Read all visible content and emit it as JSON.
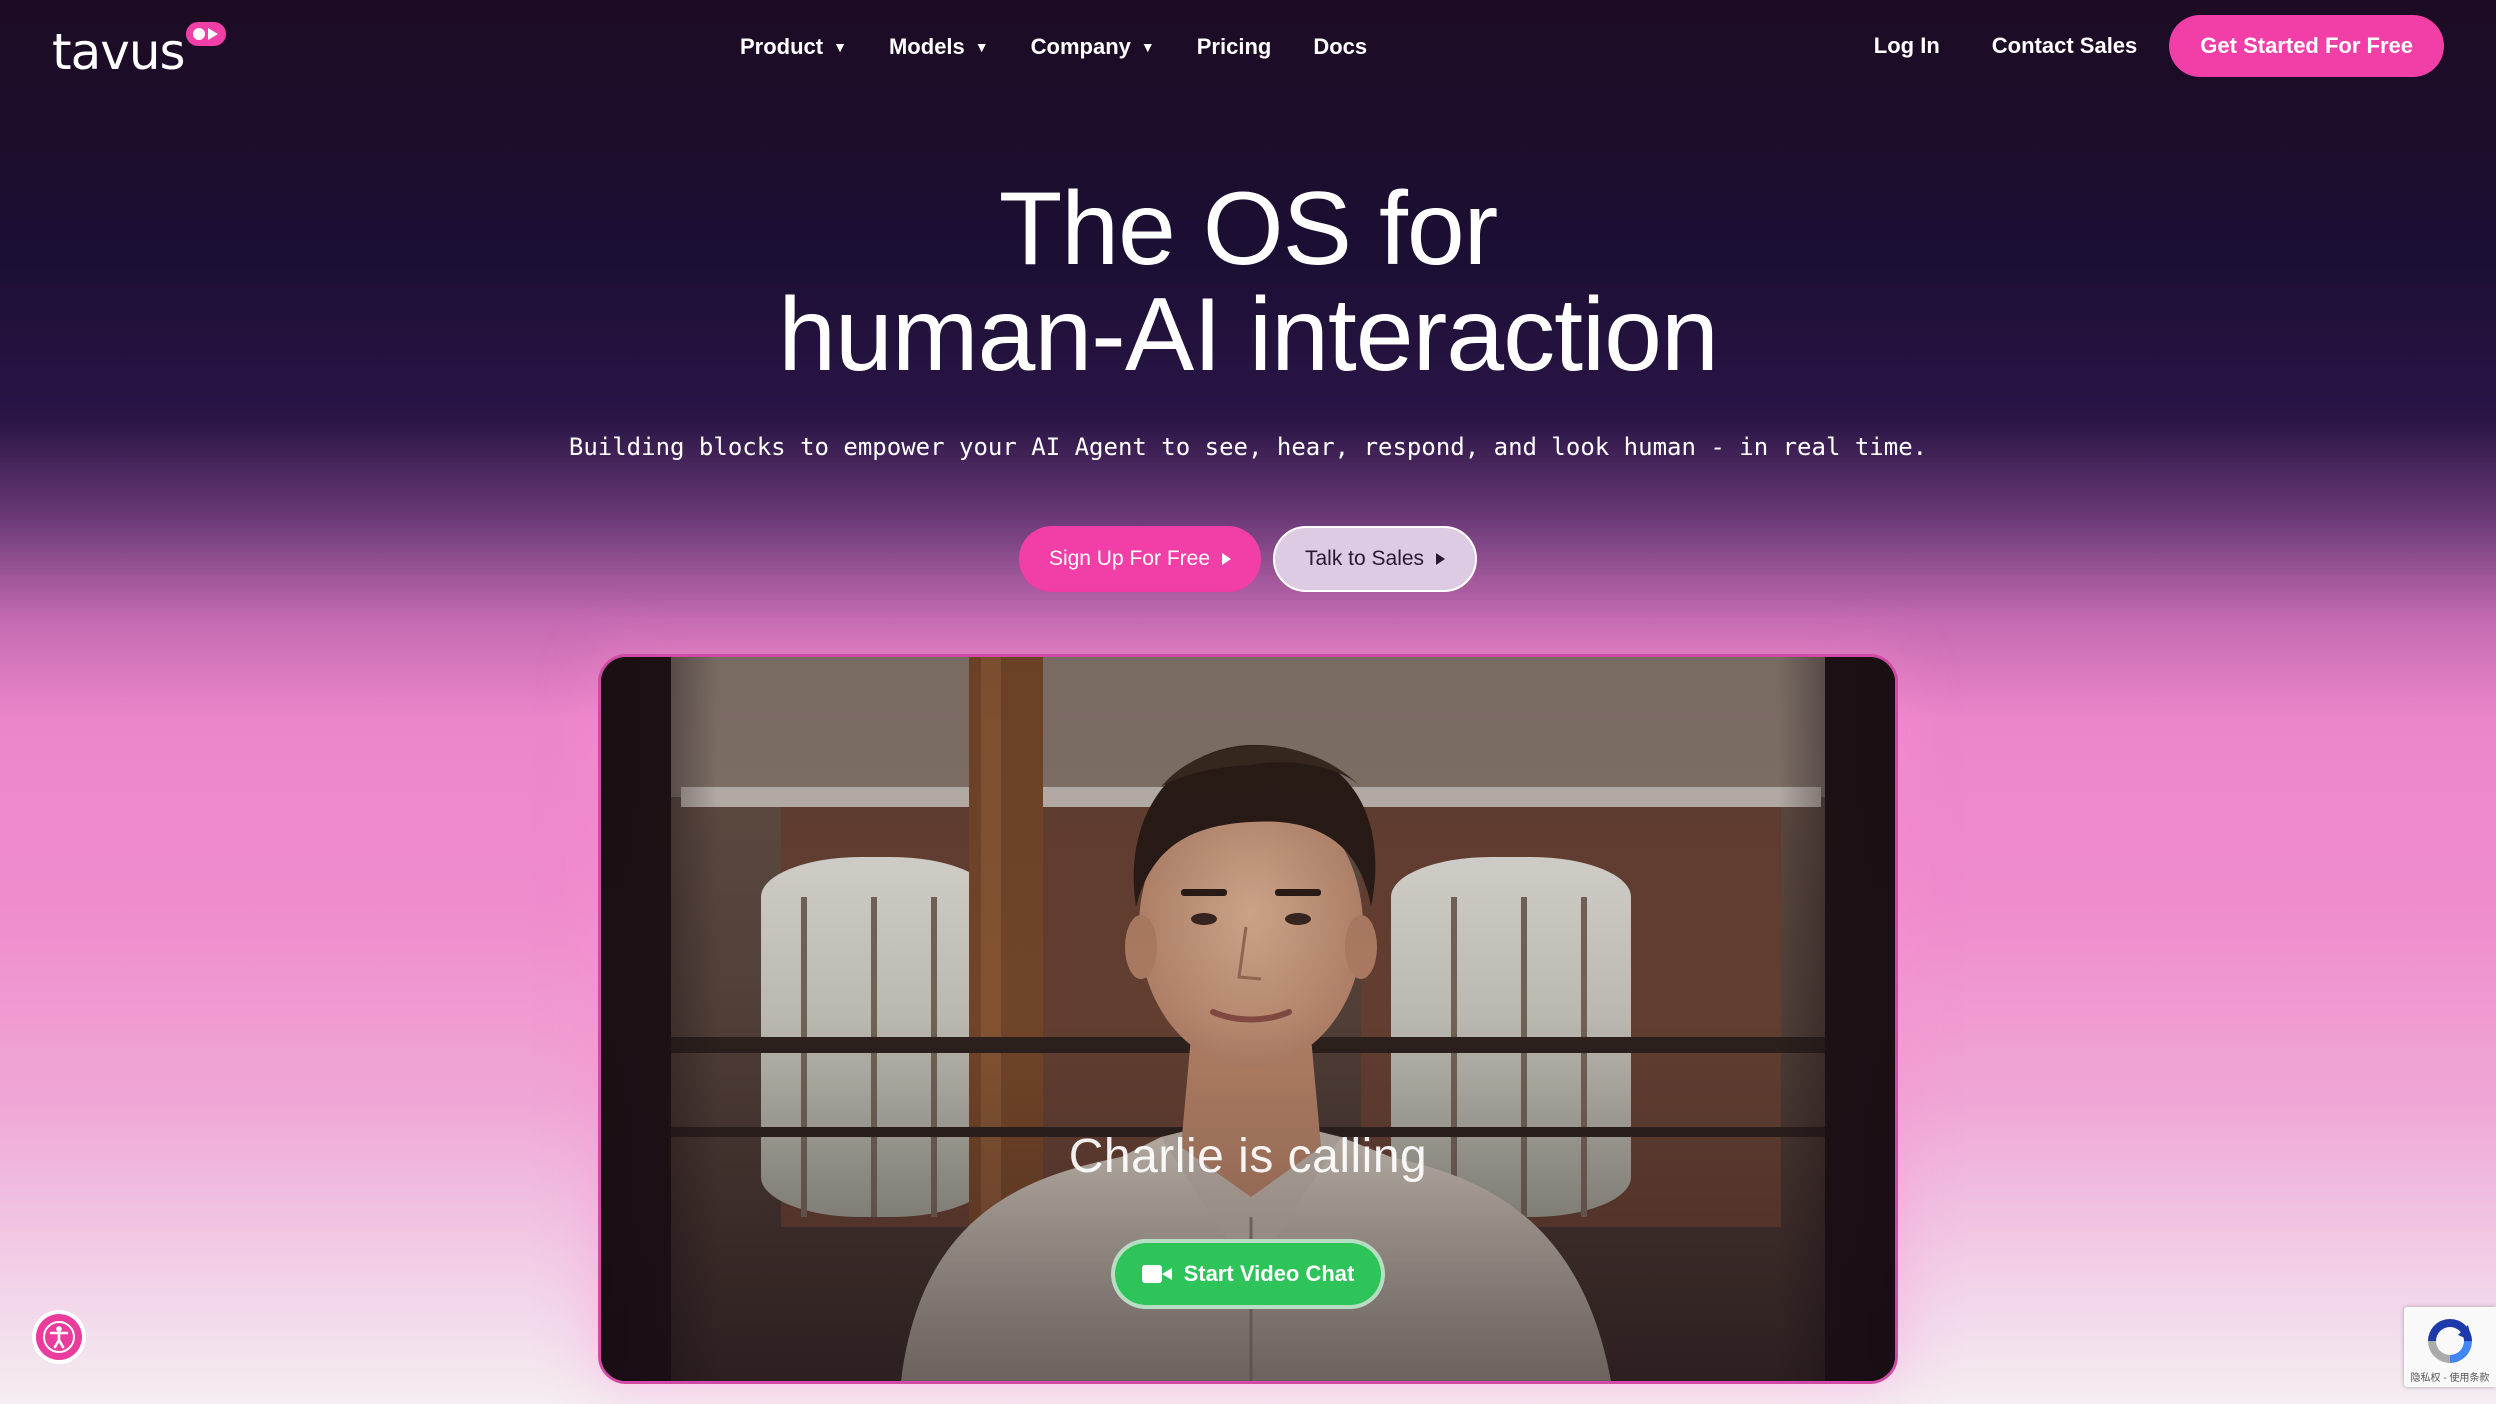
{
  "brand": {
    "logo_text": "tavus",
    "accent": "#f23ea7"
  },
  "nav": {
    "items": [
      {
        "label": "Product",
        "has_dropdown": true
      },
      {
        "label": "Models",
        "has_dropdown": true
      },
      {
        "label": "Company",
        "has_dropdown": true
      },
      {
        "label": "Pricing",
        "has_dropdown": false
      },
      {
        "label": "Docs",
        "has_dropdown": false
      }
    ],
    "caret_icon": "▼",
    "login_label": "Log In",
    "contact_label": "Contact Sales",
    "cta_label": "Get Started For Free"
  },
  "hero": {
    "title_line1": "The OS for",
    "title_line2": "human-AI interaction",
    "subtitle": "Building blocks to empower your AI Agent to see, hear, respond, and look human - in real time.",
    "primary_cta": "Sign Up For Free",
    "secondary_cta": "Talk to Sales"
  },
  "video": {
    "calling_text": "Charlie is calling",
    "button_label": "Start Video Chat",
    "button_color": "#2fc45a"
  },
  "widgets": {
    "accessibility_icon": "accessibility-icon",
    "recaptcha_text": "隐私权 - 使用条款"
  }
}
